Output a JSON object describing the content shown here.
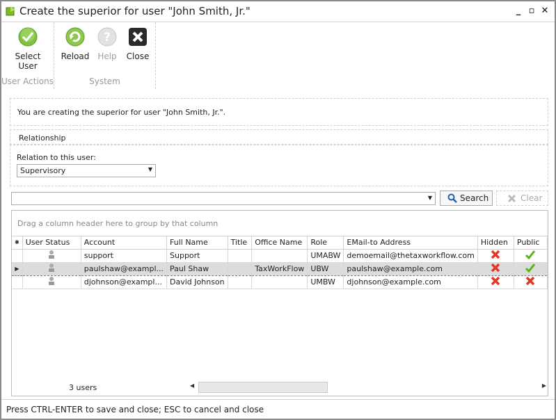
{
  "window": {
    "title": "Create the superior for user \"John Smith, Jr.\""
  },
  "ribbon": {
    "user_actions": {
      "caption": "User Actions",
      "select_user_line1": "Select",
      "select_user_line2": "User"
    },
    "system": {
      "caption": "System",
      "reload_label": "Reload",
      "help_label": "Help",
      "close_label": "Close"
    }
  },
  "info": {
    "message": "You are creating the superior for user \"John Smith, Jr.\"."
  },
  "relationship": {
    "section_title": "Relationship",
    "relation_label": "Relation to this user:",
    "relation_value": "Supervisory"
  },
  "search": {
    "value": "",
    "search_label": "Search",
    "clear_label": "Clear"
  },
  "grid": {
    "group_hint": "Drag a column header here to group by that column",
    "columns": [
      "User Status",
      "Account",
      "Full Name",
      "Title",
      "Office Name",
      "Role",
      "EMail-to Address",
      "Hidden",
      "Public"
    ],
    "rows": [
      {
        "account": "support",
        "full_name": "Support",
        "title": "",
        "office": "",
        "role": "UMABW",
        "email": "demoemail@thetaxworkflow.com",
        "hidden": false,
        "public": true
      },
      {
        "account": "paulshaw@exampl...",
        "full_name": "Paul Shaw",
        "title": "",
        "office": "TaxWorkFlow",
        "role": "UBW",
        "email": "paulshaw@example.com",
        "hidden": false,
        "public": true
      },
      {
        "account": "djohnson@exampl...",
        "full_name": "David Johnson",
        "title": "",
        "office": "",
        "role": "UMBW",
        "email": "djohnson@example.com",
        "hidden": false,
        "public": false
      }
    ],
    "footer_count": "3 users"
  },
  "statusbar": {
    "text": "Press CTRL-ENTER to save and close; ESC to cancel and close"
  },
  "colors": {
    "check_green": "#5bb318",
    "cross_red": "#e0392b",
    "accent_blue": "#1f5fb0"
  }
}
